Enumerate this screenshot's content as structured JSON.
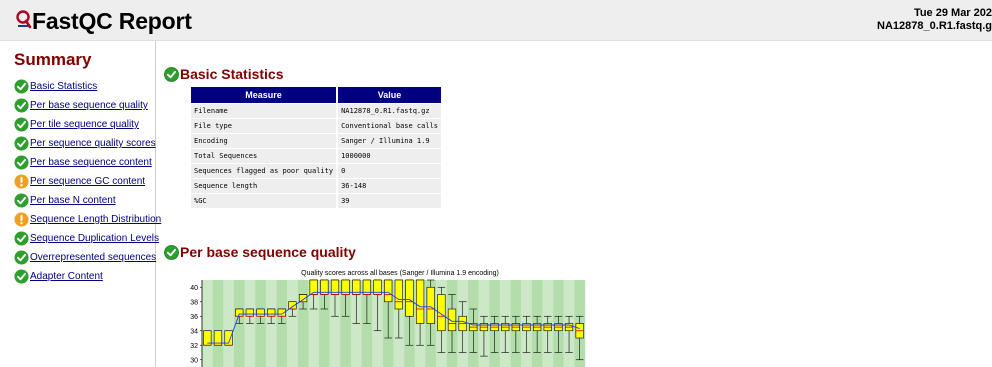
{
  "header": {
    "title": "FastQC Report",
    "date": "Tue 29 Mar 202",
    "filename": "NA12878_0.R1.fastq.g"
  },
  "summary": {
    "title": "Summary",
    "modules": [
      {
        "label": "Basic Statistics",
        "status": "pass"
      },
      {
        "label": "Per base sequence quality",
        "status": "pass"
      },
      {
        "label": "Per tile sequence quality",
        "status": "pass"
      },
      {
        "label": "Per sequence quality scores",
        "status": "pass"
      },
      {
        "label": "Per base sequence content",
        "status": "pass"
      },
      {
        "label": "Per sequence GC content",
        "status": "warn"
      },
      {
        "label": "Per base N content",
        "status": "pass"
      },
      {
        "label": "Sequence Length Distribution",
        "status": "warn"
      },
      {
        "label": "Sequence Duplication Levels",
        "status": "pass"
      },
      {
        "label": "Overrepresented sequences",
        "status": "pass"
      },
      {
        "label": "Adapter Content",
        "status": "pass"
      }
    ]
  },
  "basic_statistics": {
    "title": "Basic Statistics",
    "columns": [
      "Measure",
      "Value"
    ],
    "rows": [
      [
        "Filename",
        "NA12878_0.R1.fastq.gz"
      ],
      [
        "File type",
        "Conventional base calls"
      ],
      [
        "Encoding",
        "Sanger / Illumina 1.9"
      ],
      [
        "Total Sequences",
        "1000000"
      ],
      [
        "Sequences flagged as poor quality",
        "0"
      ],
      [
        "Sequence length",
        "36-148"
      ],
      [
        "%GC",
        "39"
      ]
    ]
  },
  "per_base_quality": {
    "title": "Per base sequence quality"
  },
  "colors": {
    "pass": "#2e9e2e",
    "warn": "#f0a020",
    "header_bg": "#eeeeee",
    "table_header": "#000080",
    "section_title": "#800000",
    "box_fill": "#ffff00",
    "stripe_light": "#cde8c6",
    "stripe_dark": "#b3deac"
  },
  "icons": {
    "pass": "check-circle-icon",
    "warn": "exclamation-circle-icon"
  },
  "chart_data": {
    "type": "box",
    "title": "Quality scores across all bases (Sanger / Illumina 1.9 encoding)",
    "xlabel": "",
    "ylabel": "",
    "ylim": [
      29,
      41
    ],
    "yticks": [
      30,
      32,
      34,
      36,
      38,
      40
    ],
    "grid": "alternating green vertical stripes",
    "boxes": [
      {
        "q1": 32,
        "q3": 34,
        "median": 32,
        "lo": 32,
        "hi": 34
      },
      {
        "q1": 32,
        "q3": 34,
        "median": 32,
        "lo": 32,
        "hi": 34
      },
      {
        "q1": 32,
        "q3": 34,
        "median": 32,
        "lo": 32,
        "hi": 34
      },
      {
        "q1": 36,
        "q3": 37,
        "median": 36,
        "lo": 35,
        "hi": 37
      },
      {
        "q1": 36,
        "q3": 37,
        "median": 36,
        "lo": 35,
        "hi": 37
      },
      {
        "q1": 36,
        "q3": 37,
        "median": 36,
        "lo": 35,
        "hi": 37
      },
      {
        "q1": 36,
        "q3": 37,
        "median": 36,
        "lo": 35,
        "hi": 37
      },
      {
        "q1": 36,
        "q3": 37,
        "median": 36,
        "lo": 35,
        "hi": 37
      },
      {
        "q1": 37,
        "q3": 38,
        "median": 37,
        "lo": 36,
        "hi": 38
      },
      {
        "q1": 38,
        "q3": 39,
        "median": 38,
        "lo": 37,
        "hi": 39
      },
      {
        "q1": 39,
        "q3": 41,
        "median": 39,
        "lo": 37,
        "hi": 41
      },
      {
        "q1": 39,
        "q3": 41,
        "median": 39,
        "lo": 37,
        "hi": 41
      },
      {
        "q1": 39,
        "q3": 41,
        "median": 39,
        "lo": 36,
        "hi": 41
      },
      {
        "q1": 39,
        "q3": 41,
        "median": 39,
        "lo": 36,
        "hi": 41
      },
      {
        "q1": 39,
        "q3": 41,
        "median": 39,
        "lo": 35,
        "hi": 41
      },
      {
        "q1": 39,
        "q3": 41,
        "median": 39,
        "lo": 35,
        "hi": 41
      },
      {
        "q1": 39,
        "q3": 41,
        "median": 39,
        "lo": 34,
        "hi": 41
      },
      {
        "q1": 38,
        "q3": 41,
        "median": 39,
        "lo": 33,
        "hi": 41
      },
      {
        "q1": 37,
        "q3": 41,
        "median": 38,
        "lo": 33,
        "hi": 41
      },
      {
        "q1": 36,
        "q3": 41,
        "median": 38,
        "lo": 32,
        "hi": 41
      },
      {
        "q1": 35,
        "q3": 41,
        "median": 37,
        "lo": 32,
        "hi": 41
      },
      {
        "q1": 35,
        "q3": 40,
        "median": 37,
        "lo": 32,
        "hi": 41
      },
      {
        "q1": 34,
        "q3": 39,
        "median": 36,
        "lo": 31,
        "hi": 40
      },
      {
        "q1": 34,
        "q3": 37,
        "median": 35,
        "lo": 31,
        "hi": 39
      },
      {
        "q1": 34,
        "q3": 36,
        "median": 35,
        "lo": 31,
        "hi": 38
      },
      {
        "q1": 34,
        "q3": 35,
        "median": 34.5,
        "lo": 31,
        "hi": 37
      },
      {
        "q1": 34,
        "q3": 35,
        "median": 34.5,
        "lo": 30.5,
        "hi": 36
      },
      {
        "q1": 34,
        "q3": 35,
        "median": 34.5,
        "lo": 31,
        "hi": 36
      },
      {
        "q1": 34,
        "q3": 35,
        "median": 34.5,
        "lo": 31,
        "hi": 36
      },
      {
        "q1": 34,
        "q3": 35,
        "median": 34.5,
        "lo": 31,
        "hi": 36
      },
      {
        "q1": 34,
        "q3": 35,
        "median": 34.5,
        "lo": 31,
        "hi": 36
      },
      {
        "q1": 34,
        "q3": 35,
        "median": 34.5,
        "lo": 31,
        "hi": 36
      },
      {
        "q1": 34,
        "q3": 35,
        "median": 34.5,
        "lo": 31,
        "hi": 36
      },
      {
        "q1": 34,
        "q3": 35,
        "median": 34.5,
        "lo": 31,
        "hi": 36
      },
      {
        "q1": 34,
        "q3": 35,
        "median": 34.5,
        "lo": 31,
        "hi": 36
      },
      {
        "q1": 33,
        "q3": 35,
        "median": 34,
        "lo": 30,
        "hi": 36
      }
    ]
  }
}
